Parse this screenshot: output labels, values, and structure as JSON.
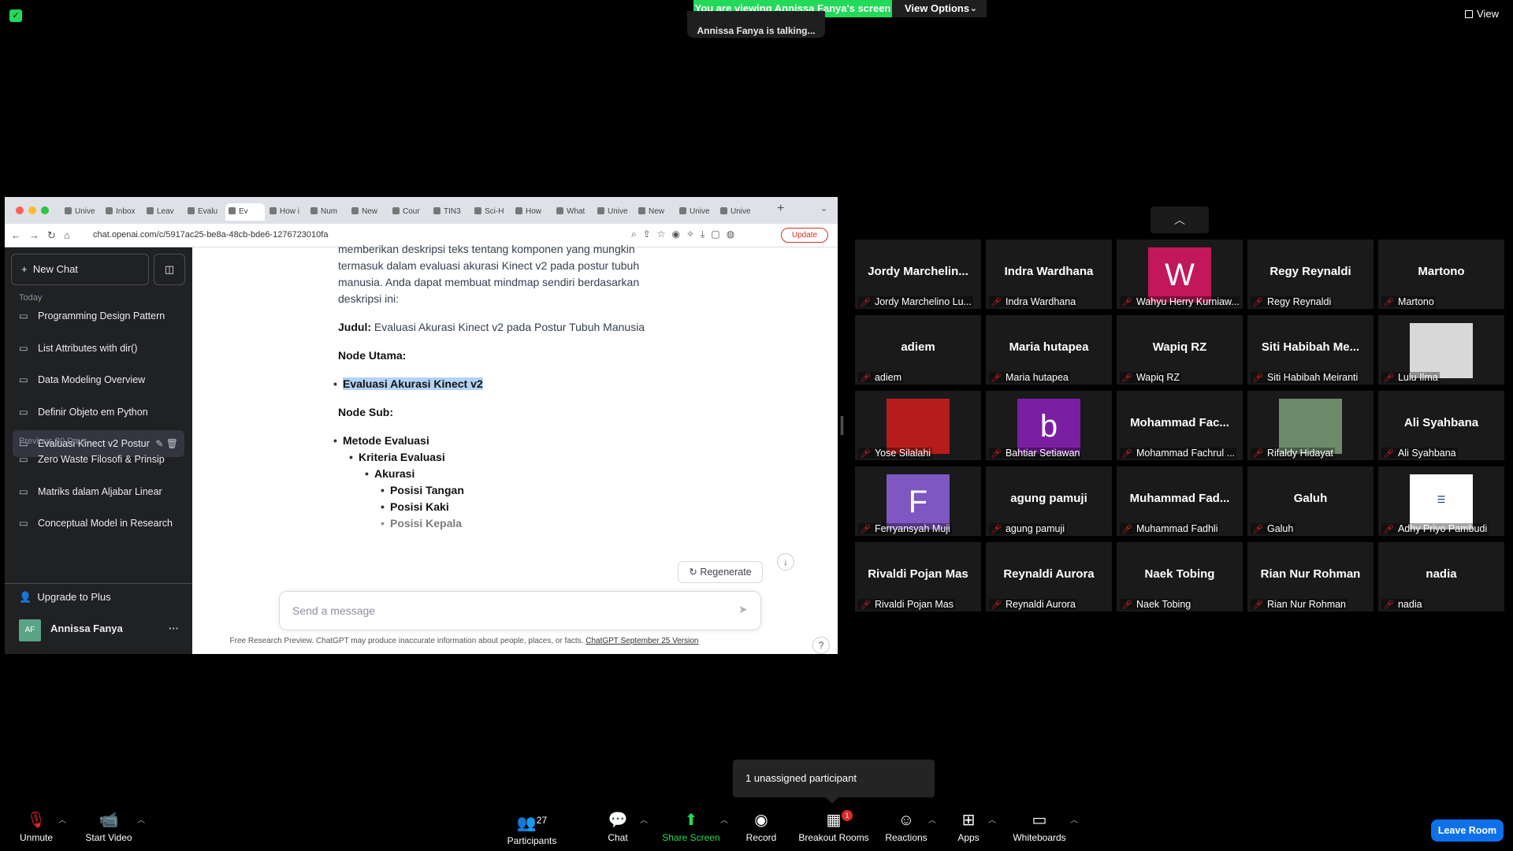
{
  "banner": {
    "viewing_text": "You are viewing Annissa Fanya's screen",
    "view_options": "View Options",
    "talking": "Annissa Fanya is talking...",
    "view_label": "View"
  },
  "browser": {
    "tabs": [
      "Unive",
      "Inbox",
      "Leav",
      "Evalu",
      "Ev",
      "How i",
      "Num",
      "New",
      "Cour",
      "TIN3",
      "Sci-H",
      "How",
      "What",
      "Unive",
      "New",
      "Unive",
      "Unive"
    ],
    "url": "chat.openai.com/c/5917ac25-be8a-48cb-bde6-1276723010fa",
    "update_label": "Update"
  },
  "sidebar": {
    "new_chat": "New Chat",
    "today_label": "Today",
    "today_items": [
      "Programming Design Pattern",
      "List Attributes with dir()",
      "Data Modeling Overview",
      "Definir Objeto em Python",
      "Evaluasi Kinect v2 Postur"
    ],
    "prev_label": "Previous 30 Days",
    "prev_items": [
      "Zero Waste Filosofi & Prinsip",
      "Matriks dalam Aljabar Linear",
      "Conceptual Model in Research"
    ],
    "upgrade": "Upgrade to Plus",
    "user_initials": "AF",
    "user_name": "Annissa Fanya"
  },
  "chat": {
    "line1": "memberikan deskripsi teks tentang komponen yang mungkin",
    "line2": "termasuk dalam evaluasi akurasi Kinect v2 pada postur tubuh",
    "line3": "manusia. Anda dapat membuat mindmap sendiri berdasarkan",
    "line4": "deskripsi ini:",
    "judul_label": "Judul:",
    "judul_text": " Evaluasi Akurasi Kinect v2 pada Postur Tubuh Manusia",
    "node_utama": "Node Utama:",
    "node_utama_item": "Evaluasi Akurasi Kinect v2",
    "node_sub": "Node Sub:",
    "metode": "Metode Evaluasi",
    "kriteria": "Kriteria Evaluasi",
    "akurasi": "Akurasi",
    "tangan": "Posisi Tangan",
    "kaki": "Posisi Kaki",
    "kepala": "Posisi Kepala",
    "regenerate": "Regenerate",
    "placeholder": "Send a message",
    "disclaimer": "Free Research Preview. ChatGPT may produce inaccurate information about people, places, or facts. ",
    "disclaimer_link": "ChatGPT September 25 Version"
  },
  "participants": [
    {
      "name": "Jordy  Marchelin...",
      "label": "Jordy Marchelino Lu..."
    },
    {
      "name": "Indra Wardhana",
      "label": "Indra Wardhana"
    },
    {
      "name": "",
      "label": "Wahyu Herry Kurniaw...",
      "avatar": "W",
      "color": "#c2185b"
    },
    {
      "name": "Regy Reynaldi",
      "label": "Regy Reynaldi"
    },
    {
      "name": "Martono",
      "label": "Martono"
    },
    {
      "name": "adiem",
      "label": "adiem"
    },
    {
      "name": "Maria hutapea",
      "label": "Maria hutapea"
    },
    {
      "name": "Wapiq RZ",
      "label": "Wapiq RZ"
    },
    {
      "name": "Siti  Habibah  Me...",
      "label": "Siti Habibah Meiranti"
    },
    {
      "name": "",
      "label": "Lulu Ilma",
      "avatar": "photo",
      "color": "#d8d8d8"
    },
    {
      "name": "",
      "label": "Yose Silalahi",
      "avatar": "photo",
      "color": "#b71c1c"
    },
    {
      "name": "",
      "label": "Bahtiar Setiawan",
      "avatar": "b",
      "color": "#7b1fa2"
    },
    {
      "name": "Mohammad  Fac...",
      "label": "Mohammad Fachrul ..."
    },
    {
      "name": "",
      "label": "Rifaldy Hidayat",
      "avatar": "photo",
      "color": "#6d8a6a"
    },
    {
      "name": "Ali Syahbana",
      "label": "Ali Syahbana"
    },
    {
      "name": "",
      "label": "Ferryansyah Muji",
      "avatar": "F",
      "color": "#7e57c2"
    },
    {
      "name": "agung pamuji",
      "label": "agung pamuji"
    },
    {
      "name": "Muhammad  Fad...",
      "label": "Muhammad Fadhli"
    },
    {
      "name": "Galuh",
      "label": "Galuh"
    },
    {
      "name": "",
      "label": "Adhy Priyo Pambudi",
      "avatar": "logo",
      "color": "#ffffff"
    },
    {
      "name": "Rivaldi Pojan Mas",
      "label": "Rivaldi Pojan Mas"
    },
    {
      "name": "Reynaldi Aurora",
      "label": "Reynaldi Aurora"
    },
    {
      "name": "Naek Tobing",
      "label": "Naek Tobing"
    },
    {
      "name": "Rian Nur Rohman",
      "label": "Rian Nur Rohman"
    },
    {
      "name": "nadia",
      "label": "nadia"
    }
  ],
  "tooltip": "1 unassigned participant",
  "toolbar": {
    "unmute": "Unmute",
    "start_video": "Start Video",
    "participants": "Participants",
    "participants_count": "27",
    "chat": "Chat",
    "share_screen": "Share Screen",
    "record": "Record",
    "breakout": "Breakout Rooms",
    "breakout_badge": "1",
    "reactions": "Reactions",
    "apps": "Apps",
    "whiteboards": "Whiteboards",
    "leave": "Leave Room"
  },
  "colors": {
    "zoom_green": "#23d959",
    "leave_blue": "#0e71eb",
    "chatgpt_sidebar": "#202123",
    "mute_red": "#e02828"
  }
}
